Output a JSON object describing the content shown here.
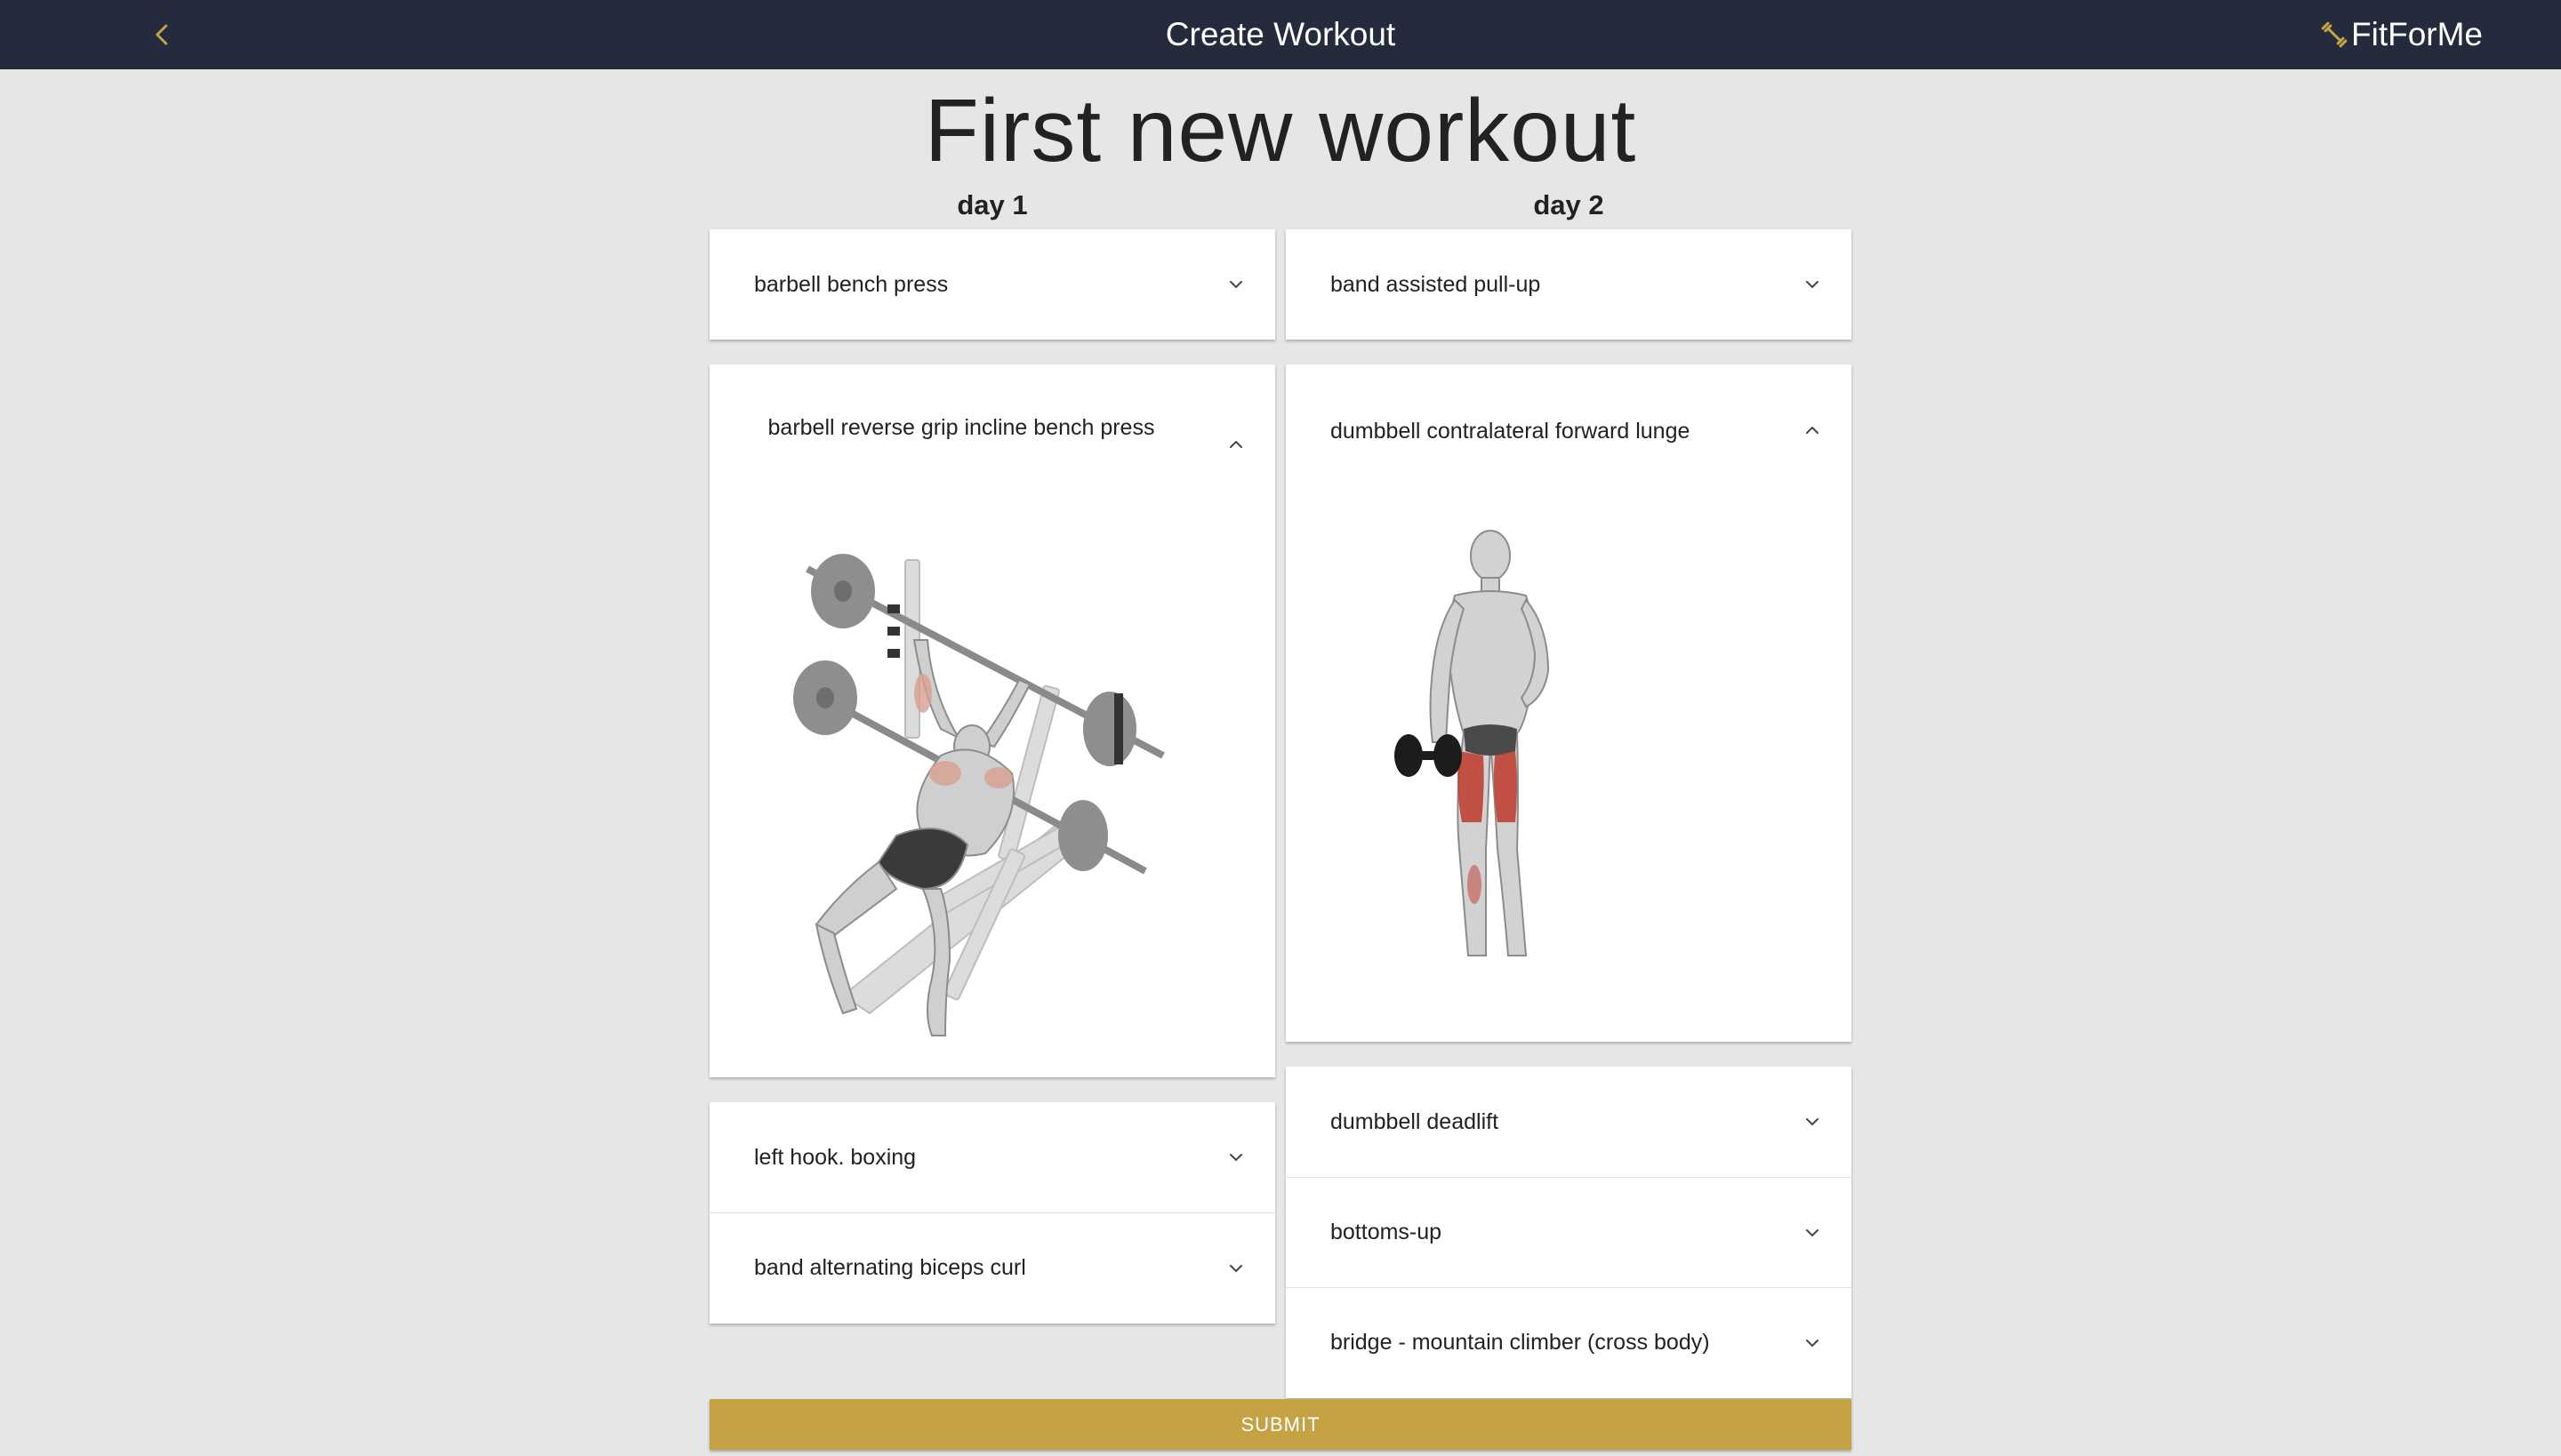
{
  "header": {
    "title": "Create Workout",
    "brand": "FitForMe"
  },
  "page_title": "First new workout",
  "days": [
    {
      "label": "day 1",
      "exercises": [
        {
          "name": "barbell bench press",
          "expanded": false
        },
        {
          "name": "barbell reverse grip incline bench press",
          "expanded": true,
          "image": "barbell-incline-bench-press-illustration"
        },
        {
          "name": "left hook. boxing",
          "expanded": false
        },
        {
          "name": "band alternating biceps curl",
          "expanded": false
        }
      ]
    },
    {
      "label": "day 2",
      "exercises": [
        {
          "name": "band assisted pull-up",
          "expanded": false
        },
        {
          "name": "dumbbell contralateral forward lunge",
          "expanded": true,
          "image": "dumbbell-lunge-illustration"
        },
        {
          "name": "dumbbell deadlift",
          "expanded": false
        },
        {
          "name": "bottoms-up",
          "expanded": false
        },
        {
          "name": "bridge - mountain climber (cross body)",
          "expanded": false
        }
      ]
    }
  ],
  "submit_label": "SUBMIT",
  "colors": {
    "topbar": "#232b3c",
    "accent": "#c5a344",
    "background": "#e6e6e6",
    "muscle_highlight": "#c0392b"
  },
  "icons": {
    "back": "chevron-left-icon",
    "brand": "dumbbell-icon",
    "collapsed": "chevron-down-icon",
    "expanded": "chevron-up-icon"
  }
}
